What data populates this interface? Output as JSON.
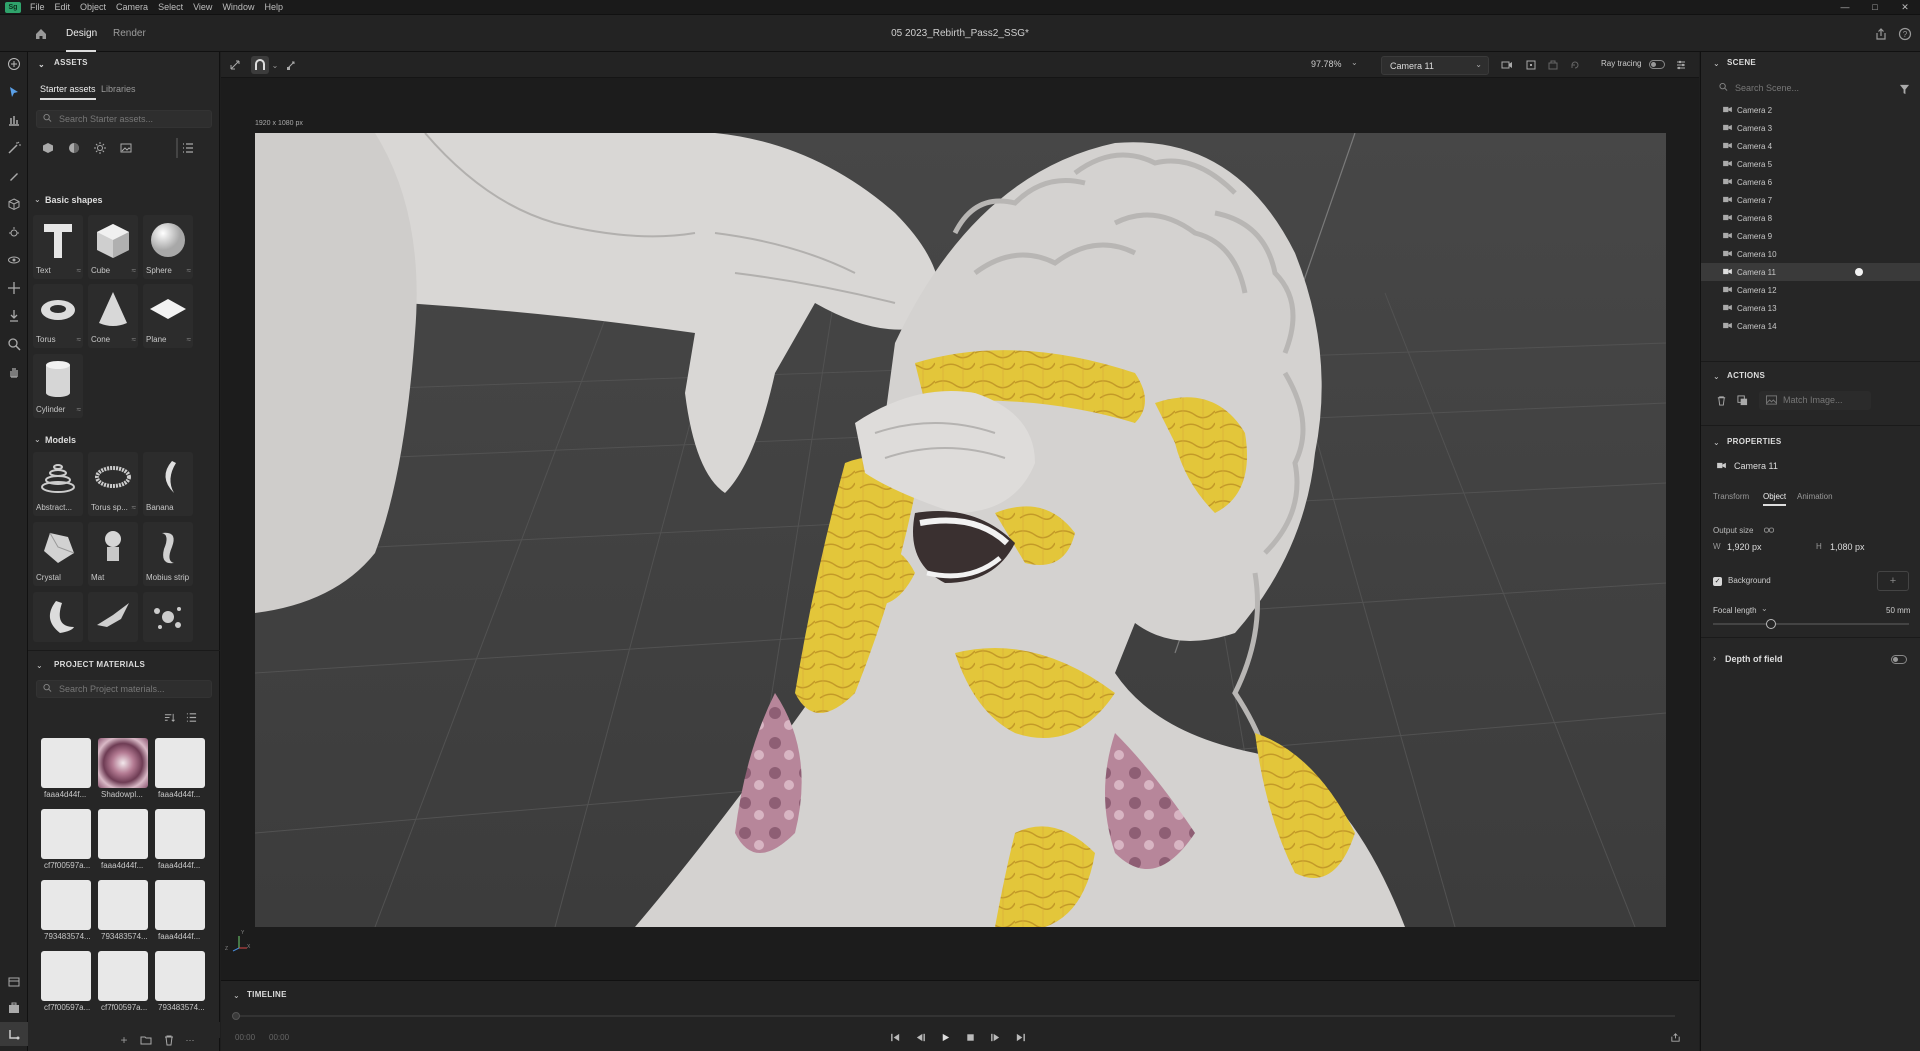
{
  "menubar": {
    "logo": "Sg",
    "items": [
      "File",
      "Edit",
      "Object",
      "Camera",
      "Select",
      "View",
      "Window",
      "Help"
    ]
  },
  "topbar": {
    "tabs": [
      "Design",
      "Render"
    ],
    "active_tab": "Design",
    "doc_title": "05 2023_Rebirth_Pass2_SSG*"
  },
  "assets": {
    "title": "ASSETS",
    "tabs": [
      "Starter assets",
      "Libraries"
    ],
    "search_placeholder": "Search Starter assets...",
    "basic_shapes_title": "Basic shapes",
    "basic_shapes": [
      "Text",
      "Cube",
      "Sphere",
      "Torus",
      "Cone",
      "Plane",
      "Cylinder"
    ],
    "models_title": "Models",
    "models": [
      "Abstract...",
      "Torus sp...",
      "Banana",
      "Crystal",
      "Mat",
      "Mobius strip",
      "",
      "",
      ""
    ],
    "project_materials_title": "PROJECT MATERIALS",
    "materials_search_placeholder": "Search Project materials...",
    "materials": [
      "faaa4d44f...",
      "Shadowpl...",
      "faaa4d44f...",
      "cf7f00597a...",
      "faaa4d44f...",
      "faaa4d44f...",
      "793483574...",
      "793483574...",
      "faaa4d44f...",
      "cf7f00597a...",
      "cf7f00597a...",
      "793483574..."
    ]
  },
  "viewport": {
    "zoom": "97.78%",
    "camera": "Camera 11",
    "ray_tracing_label": "Ray tracing",
    "ray_tracing_on": false,
    "canvas_size_label": "1920 x 1080 px",
    "axis_x": "X",
    "axis_y": "Y",
    "axis_z": "Z"
  },
  "timeline": {
    "title": "TIMELINE",
    "time_current": "00:00",
    "time_total": "00:00"
  },
  "scene": {
    "title": "SCENE",
    "search_placeholder": "Search Scene...",
    "cameras": [
      "Camera 2",
      "Camera 3",
      "Camera 4",
      "Camera 5",
      "Camera 6",
      "Camera 7",
      "Camera 8",
      "Camera 9",
      "Camera 10",
      "Camera 11",
      "Camera 12",
      "Camera 13",
      "Camera 14"
    ],
    "selected_camera": "Camera 11"
  },
  "actions": {
    "title": "ACTIONS",
    "match_image_label": "Match Image..."
  },
  "properties": {
    "title": "PROPERTIES",
    "object_name": "Camera 11",
    "tabs": [
      "Transform",
      "Object",
      "Animation"
    ],
    "active_tab": "Object",
    "output_size_label": "Output size",
    "width_label": "W",
    "width_value": "1,920 px",
    "height_label": "H",
    "height_value": "1,080 px",
    "background_label": "Background",
    "background_checked": true,
    "focal_length_label": "Focal length",
    "focal_length_value": "50 mm",
    "depth_of_field_label": "Depth of field",
    "depth_of_field_on": false
  },
  "colors": {
    "accent": "#2fa36b",
    "panel": "#262626",
    "viewport_bg": "#4a4a4a",
    "material_yellow": "#e3c63a",
    "material_pink": "#b7869a"
  }
}
